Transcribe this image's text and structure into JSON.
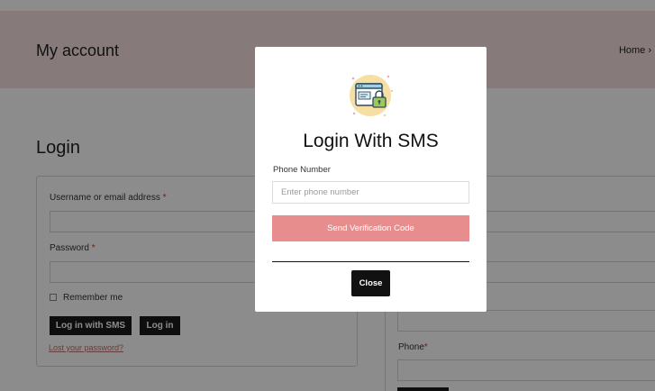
{
  "page": {
    "title": "My account",
    "breadcrumb": "Home ›"
  },
  "login_form": {
    "heading": "Login",
    "username_label": "Username or email address",
    "password_label": "Password",
    "required_mark": "*",
    "remember_label": "Remember me",
    "sms_button": "Log in with SMS",
    "login_button": "Log in",
    "lost_password": "Lost your password?"
  },
  "register_form": {
    "phone_label": "Phone",
    "required_mark": "*"
  },
  "modal": {
    "title": "Login With SMS",
    "phone_label": "Phone Number",
    "phone_placeholder": "Enter phone number",
    "send_button": "Send Verification Code",
    "close_button": "Close",
    "illustration_icon": "secure-browser-lock-icon"
  },
  "colors": {
    "hero_bg": "#f6dede",
    "accent_pink": "#e88d8d",
    "dark_button": "#1a1a1a",
    "required": "#c0392b",
    "link": "#b87070"
  }
}
